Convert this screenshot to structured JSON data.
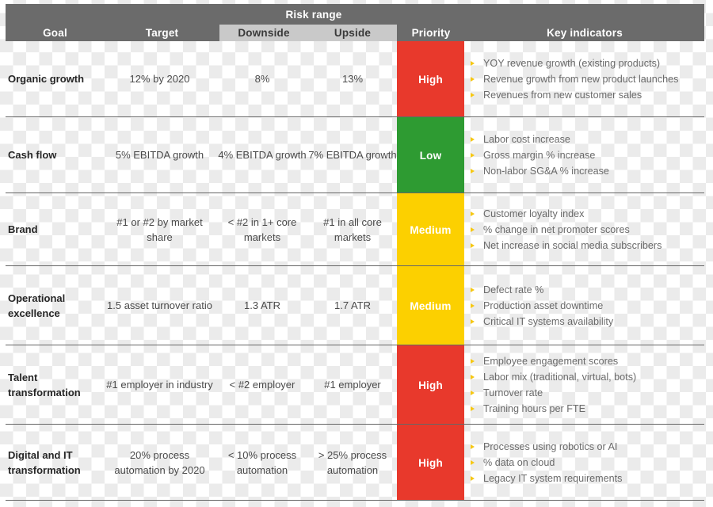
{
  "header": {
    "group_label": "Risk range",
    "columns": [
      {
        "key": "goal",
        "label": "Goal"
      },
      {
        "key": "target",
        "label": "Target"
      },
      {
        "key": "downside",
        "label": "Downside"
      },
      {
        "key": "upside",
        "label": "Upside"
      },
      {
        "key": "priority",
        "label": "Priority"
      },
      {
        "key": "key_indicators",
        "label": "Key indicators"
      }
    ]
  },
  "colors": {
    "header_bg": "#6b6b6b",
    "group_box_bg": "#c9c9c9",
    "high": "#e8392c",
    "medium": "#fcd000",
    "low": "#2e9b32",
    "bullet": "#f6c712",
    "rule": "#666666"
  },
  "rows": [
    {
      "goal": "Organic growth",
      "target": "12% by 2020",
      "downside": "8%",
      "upside": "13%",
      "priority": "High",
      "priority_level": "high",
      "key_indicators": [
        "YOY revenue growth (existing products)",
        "Revenue growth from new product launches",
        "Revenues from new customer sales"
      ]
    },
    {
      "goal": "Cash flow",
      "target": "5% EBITDA growth",
      "downside": "4% EBITDA growth",
      "upside": "7% EBITDA growth",
      "priority": "Low",
      "priority_level": "low",
      "key_indicators": [
        "Labor cost increase",
        "Gross margin % increase",
        "Non-labor SG&A % increase"
      ]
    },
    {
      "goal": "Brand",
      "target": "#1 or #2 by market share",
      "downside": "< #2 in 1+ core markets",
      "upside": "#1 in all core markets",
      "priority": "Medium",
      "priority_level": "medium",
      "key_indicators": [
        "Customer loyalty index",
        "% change in net promoter scores",
        "Net increase in social media subscribers"
      ]
    },
    {
      "goal": "Operational excellence",
      "target": "1.5 asset turnover ratio",
      "downside": "1.3 ATR",
      "upside": "1.7 ATR",
      "priority": "Medium",
      "priority_level": "medium",
      "key_indicators": [
        "Defect rate %",
        "Production asset downtime",
        "Critical IT systems availability"
      ]
    },
    {
      "goal": "Talent transformation",
      "target": "#1 employer in industry",
      "downside": "< #2 employer",
      "upside": "#1 employer",
      "priority": "High",
      "priority_level": "high",
      "key_indicators": [
        "Employee engagement scores",
        "Labor mix (traditional, virtual, bots)",
        "Turnover rate",
        "Training hours per FTE"
      ]
    },
    {
      "goal": "Digital and IT transformation",
      "target": "20% process automation by 2020",
      "downside": "< 10% process automation",
      "upside": "> 25% process automation",
      "priority": "High",
      "priority_level": "high",
      "key_indicators": [
        "Processes using robotics or AI",
        "% data on cloud",
        "Legacy IT system requirements"
      ]
    }
  ]
}
